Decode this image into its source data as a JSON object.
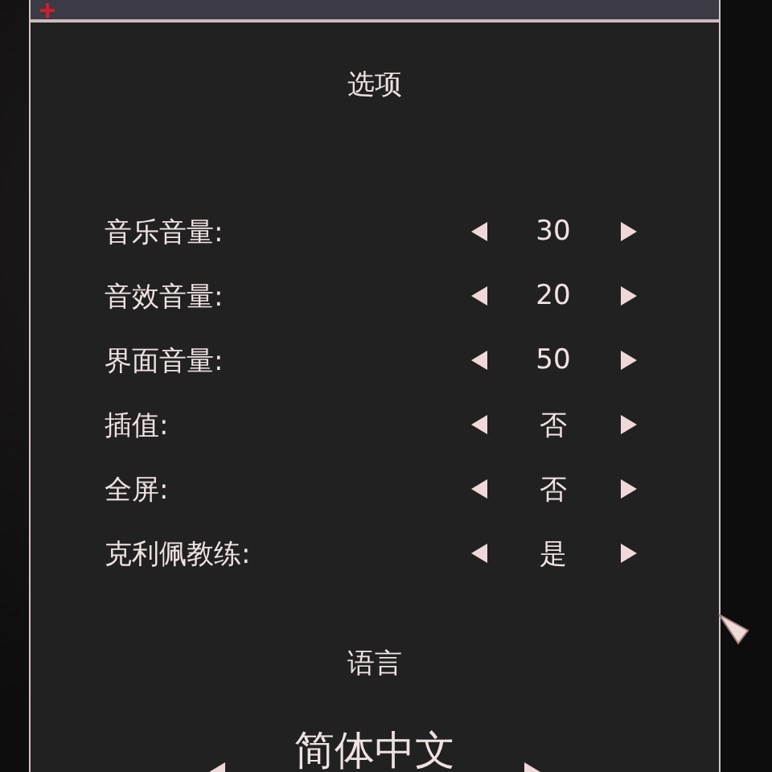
{
  "title": "选项",
  "options": [
    {
      "label": "音乐音量:",
      "value": "30"
    },
    {
      "label": "音效音量:",
      "value": "20"
    },
    {
      "label": "界面音量:",
      "value": "50"
    },
    {
      "label": "插值:",
      "value": "否"
    },
    {
      "label": "全屏:",
      "value": "否"
    },
    {
      "label": "克利佩教练:",
      "value": "是"
    }
  ],
  "language": {
    "title": "语言",
    "value": "简体中文"
  }
}
